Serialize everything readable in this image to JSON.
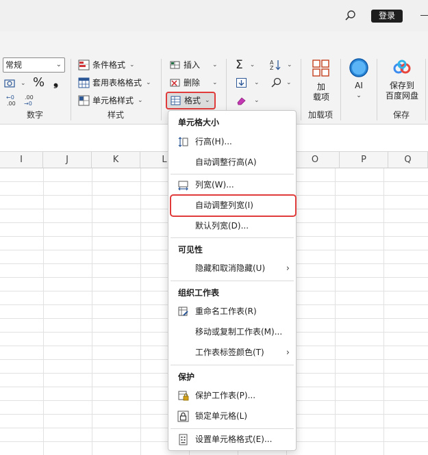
{
  "titlebar": {
    "login_label": "登录"
  },
  "ribbon": {
    "number_format_value": "常规",
    "percent_symbol": "%",
    "comma_symbol": "❟",
    "groups": {
      "number": "数字",
      "styles": "样式",
      "addins": "加载项",
      "save": "保存"
    },
    "styles": {
      "conditional_format": "条件格式",
      "table_format": "套用表格格式",
      "cell_styles": "单元格样式"
    },
    "cells": {
      "insert": "插入",
      "delete": "删除",
      "format": "格式"
    },
    "addins_label_line1": "加",
    "addins_label_line2": "载项",
    "ai_label": "AI",
    "save_label_line1": "保存到",
    "save_label_line2": "百度网盘"
  },
  "grid": {
    "columns": [
      "I",
      "J",
      "K",
      "L",
      "O",
      "P",
      "Q"
    ]
  },
  "menu": {
    "section_cell_size": "单元格大小",
    "row_height": "行高(H)...",
    "autofit_row": "自动调整行高(A)",
    "col_width": "列宽(W)...",
    "autofit_col": "自动调整列宽(I)",
    "default_width": "默认列宽(D)...",
    "section_visibility": "可见性",
    "hide_unhide": "隐藏和取消隐藏(U)",
    "section_organize": "组织工作表",
    "rename_sheet": "重命名工作表(R)",
    "move_copy": "移动或复制工作表(M)...",
    "tab_color": "工作表标签颜色(T)",
    "section_protect": "保护",
    "protect_sheet": "保护工作表(P)...",
    "lock_cell": "锁定单元格(L)",
    "format_cells": "设置单元格格式(E)..."
  },
  "colors": {
    "highlight": "#e03a3a",
    "accent": "#217346"
  }
}
